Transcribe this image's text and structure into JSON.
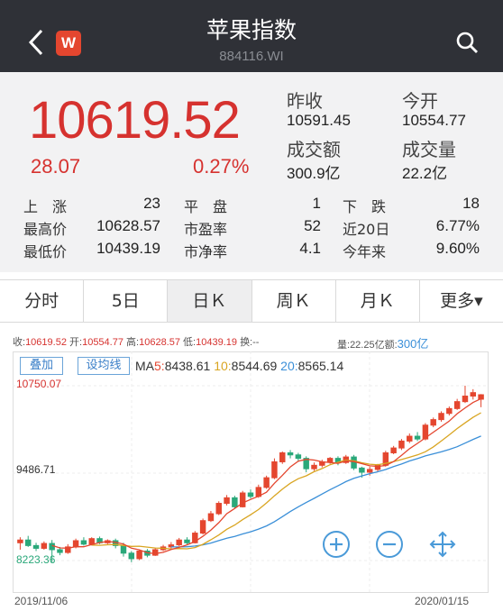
{
  "header": {
    "title": "苹果指数",
    "code": "884116.WI",
    "logo_text": "W"
  },
  "quote": {
    "price": "10619.52",
    "change": "28.07",
    "change_pct": "0.27%",
    "prev_close_label": "昨收",
    "prev_close": "10591.45",
    "open_label": "今开",
    "open": "10554.77",
    "turnover_label": "成交额",
    "turnover": "300.9亿",
    "volume_label": "成交量",
    "volume": "22.2亿",
    "rows": [
      {
        "l1": "上　涨",
        "v1": "23",
        "l2": "平　盘",
        "v2": "1",
        "l3": "下　跌",
        "v3": "18"
      },
      {
        "l1": "最高价",
        "v1": "10628.57",
        "l2": "市盈率",
        "v2": "52",
        "l3": "近20日",
        "v3": "6.77%"
      },
      {
        "l1": "最低价",
        "v1": "10439.19",
        "l2": "市净率",
        "v2": "4.1",
        "l3": "今年来",
        "v3": "9.60%"
      }
    ]
  },
  "tabs": [
    "分时",
    "5日",
    "日Ｋ",
    "周Ｋ",
    "月Ｋ",
    "更多▾"
  ],
  "active_tab": 2,
  "info": {
    "close_label": "收:",
    "close": "10619.52",
    "open_label": "开:",
    "open": "10554.77",
    "high_label": "高:",
    "high": "10628.57",
    "low_label": "低:",
    "low": "10439.19",
    "turnover_rate_label": "换:",
    "turnover_rate": "--",
    "vol_label": "量:",
    "vol": "22.25亿",
    "amt_label": "额:",
    "amt": "300亿"
  },
  "chart_buttons": {
    "overlay": "叠加",
    "set_ma": "设均线"
  },
  "ma": {
    "prefix": "MA",
    "ma5_label": "5:",
    "ma5": "8438.61",
    "ma10_label": "10:",
    "ma10": "8544.69",
    "ma20_label": "20:",
    "ma20": "8565.14"
  },
  "chart_data": {
    "type": "candlestick",
    "y_labels": [
      "10750.07",
      "9486.71",
      "8223.36"
    ],
    "ylim": [
      8223.36,
      10750.07
    ],
    "x_start": "2019/11/06",
    "x_end": "2020/01/15",
    "candles": [
      [
        8480,
        8520,
        8560,
        8380
      ],
      [
        8520,
        8440,
        8580,
        8420
      ],
      [
        8440,
        8400,
        8480,
        8360
      ],
      [
        8400,
        8470,
        8500,
        8380
      ],
      [
        8470,
        8380,
        8520,
        8200
      ],
      [
        8380,
        8340,
        8420,
        8300
      ],
      [
        8340,
        8420,
        8460,
        8320
      ],
      [
        8420,
        8510,
        8540,
        8400
      ],
      [
        8510,
        8460,
        8560,
        8440
      ],
      [
        8460,
        8540,
        8560,
        8440
      ],
      [
        8540,
        8480,
        8570,
        8460
      ],
      [
        8480,
        8510,
        8530,
        8460
      ],
      [
        8510,
        8440,
        8540,
        8400
      ],
      [
        8440,
        8330,
        8480,
        8280
      ],
      [
        8330,
        8250,
        8360,
        8200
      ],
      [
        8250,
        8360,
        8380,
        8230
      ],
      [
        8360,
        8300,
        8390,
        8270
      ],
      [
        8300,
        8380,
        8410,
        8290
      ],
      [
        8380,
        8420,
        8450,
        8360
      ],
      [
        8420,
        8450,
        8490,
        8400
      ],
      [
        8450,
        8520,
        8550,
        8430
      ],
      [
        8520,
        8480,
        8560,
        8450
      ],
      [
        8480,
        8620,
        8650,
        8470
      ],
      [
        8620,
        8800,
        8830,
        8600
      ],
      [
        8800,
        8900,
        8940,
        8780
      ],
      [
        8900,
        9050,
        9080,
        8880
      ],
      [
        9050,
        9130,
        9170,
        9020
      ],
      [
        9130,
        9000,
        9160,
        8970
      ],
      [
        9000,
        9200,
        9230,
        8990
      ],
      [
        9200,
        9150,
        9250,
        9120
      ],
      [
        9150,
        9280,
        9320,
        9130
      ],
      [
        9280,
        9420,
        9450,
        9260
      ],
      [
        9420,
        9650,
        9700,
        9400
      ],
      [
        9650,
        9780,
        9800,
        9620
      ],
      [
        9780,
        9750,
        9820,
        9700
      ],
      [
        9750,
        9700,
        9780,
        9650
      ],
      [
        9700,
        9550,
        9730,
        9500
      ],
      [
        9550,
        9600,
        9640,
        9520
      ],
      [
        9600,
        9650,
        9680,
        9570
      ],
      [
        9650,
        9700,
        9720,
        9620
      ],
      [
        9700,
        9640,
        9730,
        9600
      ],
      [
        9640,
        9720,
        9750,
        9620
      ],
      [
        9720,
        9560,
        9750,
        9530
      ],
      [
        9560,
        9500,
        9580,
        9420
      ],
      [
        9500,
        9540,
        9580,
        9450
      ],
      [
        9540,
        9600,
        9620,
        9500
      ],
      [
        9600,
        9780,
        9810,
        9580
      ],
      [
        9780,
        9850,
        9880,
        9760
      ],
      [
        9850,
        9950,
        9980,
        9820
      ],
      [
        9950,
        10020,
        10060,
        9920
      ],
      [
        10020,
        9980,
        10080,
        9950
      ],
      [
        9980,
        10180,
        10210,
        9960
      ],
      [
        10180,
        10260,
        10290,
        10150
      ],
      [
        10260,
        10350,
        10380,
        10230
      ],
      [
        10350,
        10420,
        10450,
        10320
      ],
      [
        10420,
        10520,
        10560,
        10400
      ],
      [
        10520,
        10600,
        10750,
        10500
      ],
      [
        10600,
        10650,
        10700,
        10550
      ],
      [
        10554.77,
        10619.52,
        10628.57,
        10439.19
      ]
    ]
  },
  "colors": {
    "up": "#e4462f",
    "down": "#2aa87a",
    "ma5": "#e4462f",
    "ma10": "#d9a521",
    "ma20": "#3a8fd8",
    "accent_red": "#d6322f"
  },
  "icons": [
    "back-arrow-icon",
    "app-logo-icon",
    "search-icon",
    "zoom-in-icon",
    "zoom-out-icon",
    "fullscreen-icon"
  ]
}
